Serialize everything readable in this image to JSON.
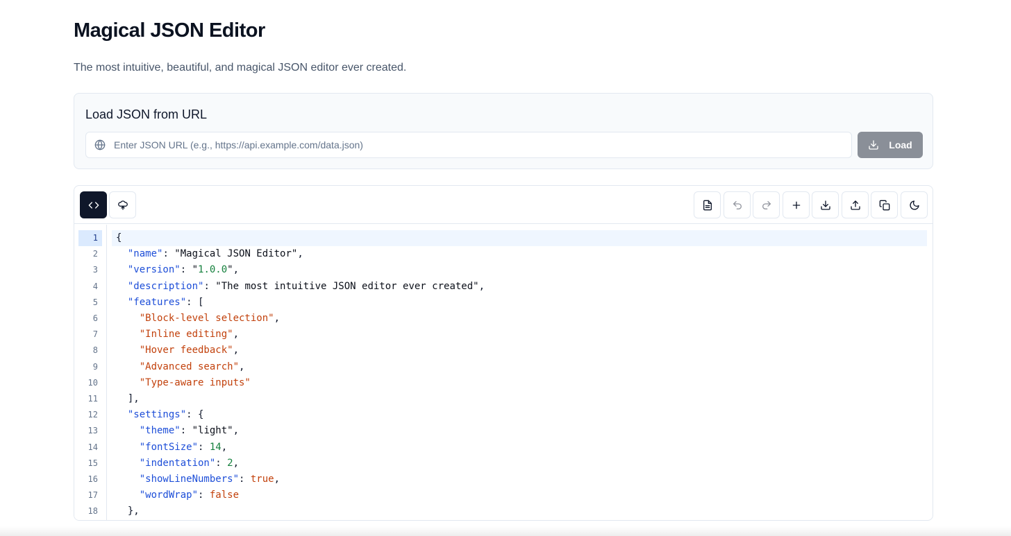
{
  "header": {
    "title": "Magical JSON Editor",
    "subtitle": "The most intuitive, beautiful, and magical JSON editor ever created."
  },
  "url_loader": {
    "heading": "Load JSON from URL",
    "input_placeholder": "Enter JSON URL (e.g., https://api.example.com/data.json)",
    "input_value": "",
    "load_label": "Load"
  },
  "toolbar": {
    "left": [
      {
        "name": "code-view-button",
        "icon": "code-icon",
        "active": true
      },
      {
        "name": "tree-view-button",
        "icon": "tree-icon",
        "active": false
      }
    ],
    "right": [
      {
        "name": "format-button",
        "icon": "file-text-icon"
      },
      {
        "name": "undo-button",
        "icon": "undo-icon",
        "disabled": true
      },
      {
        "name": "redo-button",
        "icon": "redo-icon",
        "disabled": true
      },
      {
        "name": "add-button",
        "icon": "plus-icon"
      },
      {
        "name": "download-button",
        "icon": "download-icon"
      },
      {
        "name": "upload-button",
        "icon": "upload-icon"
      },
      {
        "name": "copy-button",
        "icon": "copy-icon"
      },
      {
        "name": "theme-toggle-button",
        "icon": "moon-icon"
      }
    ]
  },
  "editor": {
    "current_line": 1,
    "lines": [
      {
        "n": "1",
        "tokens": [
          {
            "t": "{",
            "c": "p"
          }
        ]
      },
      {
        "n": "2",
        "tokens": [
          {
            "t": "  ",
            "c": "p"
          },
          {
            "t": "\"name\"",
            "c": "k"
          },
          {
            "t": ": ",
            "c": "p"
          },
          {
            "t": "\"Magical JSON Editor\"",
            "c": "s"
          },
          {
            "t": ",",
            "c": "p"
          }
        ]
      },
      {
        "n": "3",
        "tokens": [
          {
            "t": "  ",
            "c": "p"
          },
          {
            "t": "\"version\"",
            "c": "k"
          },
          {
            "t": ": ",
            "c": "p"
          },
          {
            "t": "\"",
            "c": "s"
          },
          {
            "t": "1.0.0",
            "c": "sg"
          },
          {
            "t": "\"",
            "c": "s"
          },
          {
            "t": ",",
            "c": "p"
          }
        ]
      },
      {
        "n": "4",
        "tokens": [
          {
            "t": "  ",
            "c": "p"
          },
          {
            "t": "\"description\"",
            "c": "k"
          },
          {
            "t": ": ",
            "c": "p"
          },
          {
            "t": "\"The most intuitive JSON editor ever created\"",
            "c": "s"
          },
          {
            "t": ",",
            "c": "p"
          }
        ]
      },
      {
        "n": "5",
        "tokens": [
          {
            "t": "  ",
            "c": "p"
          },
          {
            "t": "\"features\"",
            "c": "k"
          },
          {
            "t": ": [",
            "c": "p"
          }
        ]
      },
      {
        "n": "6",
        "tokens": [
          {
            "t": "    ",
            "c": "p"
          },
          {
            "t": "\"Block-level selection\"",
            "c": "sa"
          },
          {
            "t": ",",
            "c": "p"
          }
        ]
      },
      {
        "n": "7",
        "tokens": [
          {
            "t": "    ",
            "c": "p"
          },
          {
            "t": "\"Inline editing\"",
            "c": "sa"
          },
          {
            "t": ",",
            "c": "p"
          }
        ]
      },
      {
        "n": "8",
        "tokens": [
          {
            "t": "    ",
            "c": "p"
          },
          {
            "t": "\"Hover feedback\"",
            "c": "sa"
          },
          {
            "t": ",",
            "c": "p"
          }
        ]
      },
      {
        "n": "9",
        "tokens": [
          {
            "t": "    ",
            "c": "p"
          },
          {
            "t": "\"Advanced search\"",
            "c": "sa"
          },
          {
            "t": ",",
            "c": "p"
          }
        ]
      },
      {
        "n": "10",
        "tokens": [
          {
            "t": "    ",
            "c": "p"
          },
          {
            "t": "\"Type-aware inputs\"",
            "c": "sa"
          }
        ]
      },
      {
        "n": "11",
        "tokens": [
          {
            "t": "  ],",
            "c": "p"
          }
        ]
      },
      {
        "n": "12",
        "tokens": [
          {
            "t": "  ",
            "c": "p"
          },
          {
            "t": "\"settings\"",
            "c": "k"
          },
          {
            "t": ": {",
            "c": "p"
          }
        ]
      },
      {
        "n": "13",
        "tokens": [
          {
            "t": "    ",
            "c": "p"
          },
          {
            "t": "\"theme\"",
            "c": "k"
          },
          {
            "t": ": ",
            "c": "p"
          },
          {
            "t": "\"light\"",
            "c": "s"
          },
          {
            "t": ",",
            "c": "p"
          }
        ]
      },
      {
        "n": "14",
        "tokens": [
          {
            "t": "    ",
            "c": "p"
          },
          {
            "t": "\"fontSize\"",
            "c": "k"
          },
          {
            "t": ": ",
            "c": "p"
          },
          {
            "t": "14",
            "c": "n"
          },
          {
            "t": ",",
            "c": "p"
          }
        ]
      },
      {
        "n": "15",
        "tokens": [
          {
            "t": "    ",
            "c": "p"
          },
          {
            "t": "\"indentation\"",
            "c": "k"
          },
          {
            "t": ": ",
            "c": "p"
          },
          {
            "t": "2",
            "c": "n"
          },
          {
            "t": ",",
            "c": "p"
          }
        ]
      },
      {
        "n": "16",
        "tokens": [
          {
            "t": "    ",
            "c": "p"
          },
          {
            "t": "\"showLineNumbers\"",
            "c": "k"
          },
          {
            "t": ": ",
            "c": "p"
          },
          {
            "t": "true",
            "c": "b"
          },
          {
            "t": ",",
            "c": "p"
          }
        ]
      },
      {
        "n": "17",
        "tokens": [
          {
            "t": "    ",
            "c": "p"
          },
          {
            "t": "\"wordWrap\"",
            "c": "k"
          },
          {
            "t": ": ",
            "c": "p"
          },
          {
            "t": "false",
            "c": "b"
          }
        ]
      },
      {
        "n": "18",
        "tokens": [
          {
            "t": "  },",
            "c": "p"
          }
        ]
      }
    ]
  }
}
